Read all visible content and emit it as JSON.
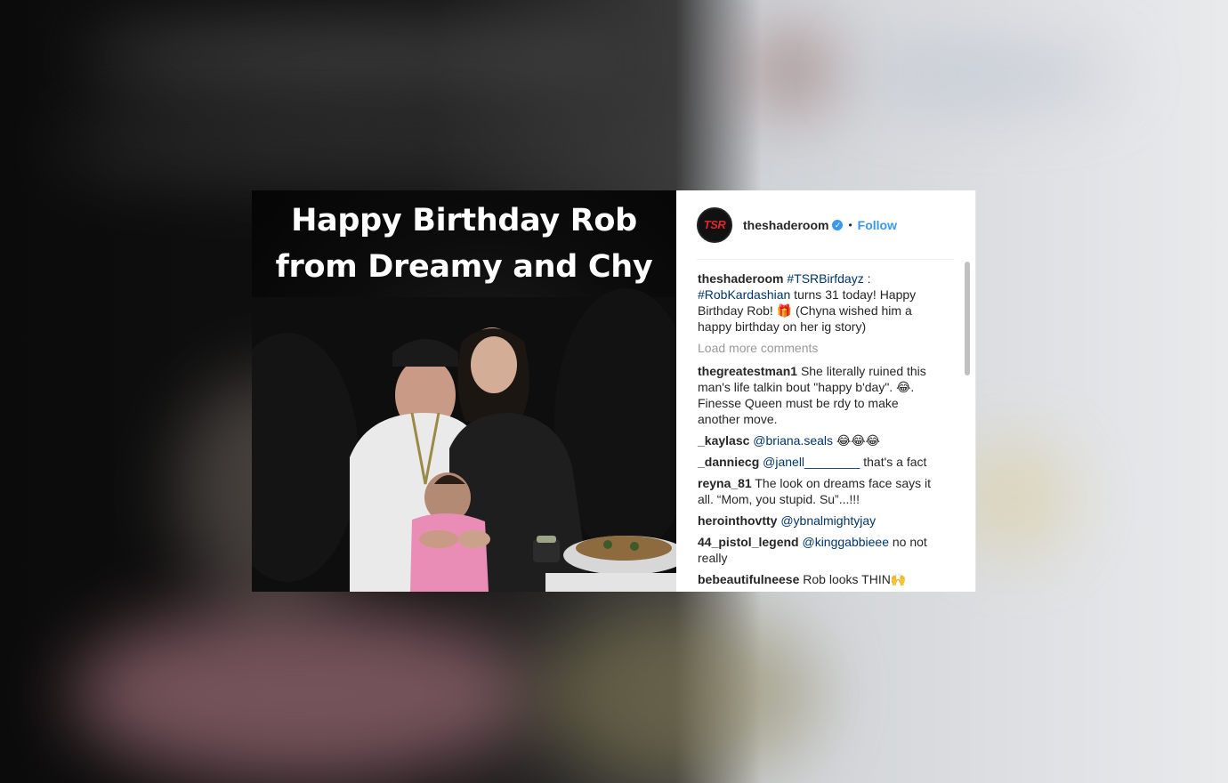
{
  "post": {
    "image_caption_lines": [
      "Happy Birthday Rob",
      "from Dreamy and Chy"
    ],
    "avatar_text": "TSR",
    "username": "theshaderoom",
    "verified_mark": "✓",
    "dot": "•",
    "follow_label": "Follow",
    "caption": {
      "user": "theshaderoom",
      "tag1": "#TSRBirfdayz",
      "text1": " : ",
      "tag2": "#RobKardashian",
      "text2": " turns 31 today! Happy Birthday Rob! 🎁 (Chyna wished him a happy birthday on her ig story)"
    },
    "load_more_label": "Load more comments",
    "comments": [
      {
        "user": "thegreatestman1",
        "text": "She literally ruined this man's life talkin bout \"happy b'day\". 😂. Finesse Queen must be rdy to make another move."
      },
      {
        "user": "_kaylasc",
        "mention": "@briana.seals",
        "text": " 😂😂😂"
      },
      {
        "user": "_danniecg",
        "mention": "@janell________",
        "text": " that's a fact"
      },
      {
        "user": "reyna_81",
        "text": "The look on dreams face says it all. “Mom, you stupid. Su”...!!!"
      },
      {
        "user": "herointhovtty",
        "mention": "@ybnalmightyjay",
        "text": ""
      },
      {
        "user": "44_pistol_legend",
        "mention": "@kinggabbieee",
        "text": " no not really"
      },
      {
        "user": "bebeautifulneese",
        "text": "Rob looks THIN🙌"
      }
    ]
  },
  "colors": {
    "accent": "#3897f0",
    "tag": "#003569",
    "tsr_red": "#e0262b"
  }
}
